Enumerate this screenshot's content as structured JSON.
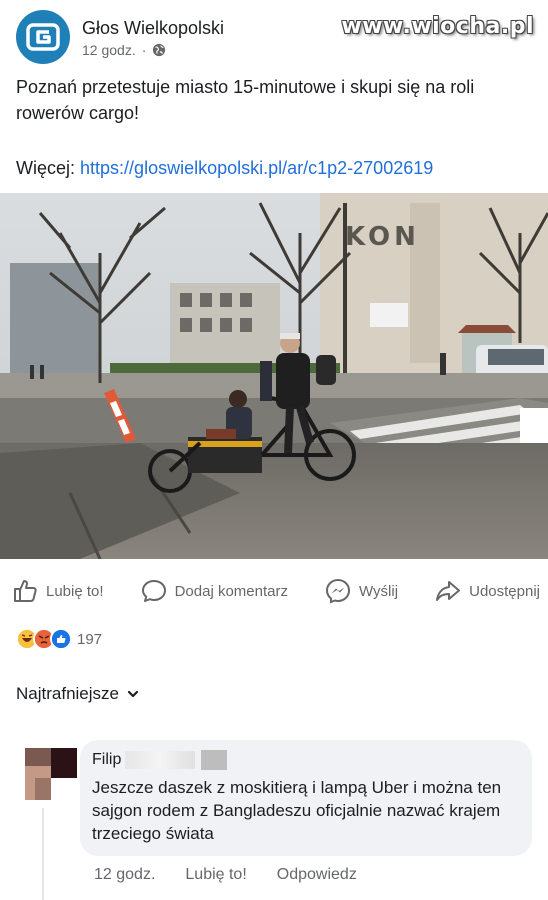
{
  "watermark": "www.wiocha.pl",
  "post": {
    "page_name": "Głos Wielkopolski",
    "time": "12 godz.",
    "separator": "·",
    "text": "Poznań przetestuje miasto 15-minutowe i skupi się na roli rowerów cargo!",
    "more_label": "Więcej:",
    "more_link": "https://gloswielkopolski.pl/ar/c1p2-27002619"
  },
  "actions": {
    "like": "Lubię to!",
    "comment": "Dodaj komentarz",
    "send": "Wyślij",
    "share": "Udostępnij"
  },
  "reactions": {
    "count": "197",
    "types": [
      "haha",
      "angry",
      "like"
    ]
  },
  "sort": {
    "label": "Najtrafniejsze"
  },
  "comment": {
    "author_visible": "Filip",
    "text": "Jeszcze daszek z moskitierą i lampą Uber i można ten sajgon rodem z Bangladeszu oficjalnie nazwać krajem trzeciego świata",
    "time": "12 godz.",
    "like": "Lubię to!",
    "reply": "Odpowiedz"
  },
  "photo": {
    "sign_text": "KON"
  },
  "colors": {
    "link": "#216fdb",
    "brand": "#1f7fb7",
    "secondary_text": "#65676b",
    "bubble": "#f0f2f5"
  },
  "icons": [
    "logo-icon",
    "globe-icon",
    "thumbs-up-icon",
    "comment-icon",
    "messenger-icon",
    "share-icon",
    "chevron-down-icon"
  ]
}
